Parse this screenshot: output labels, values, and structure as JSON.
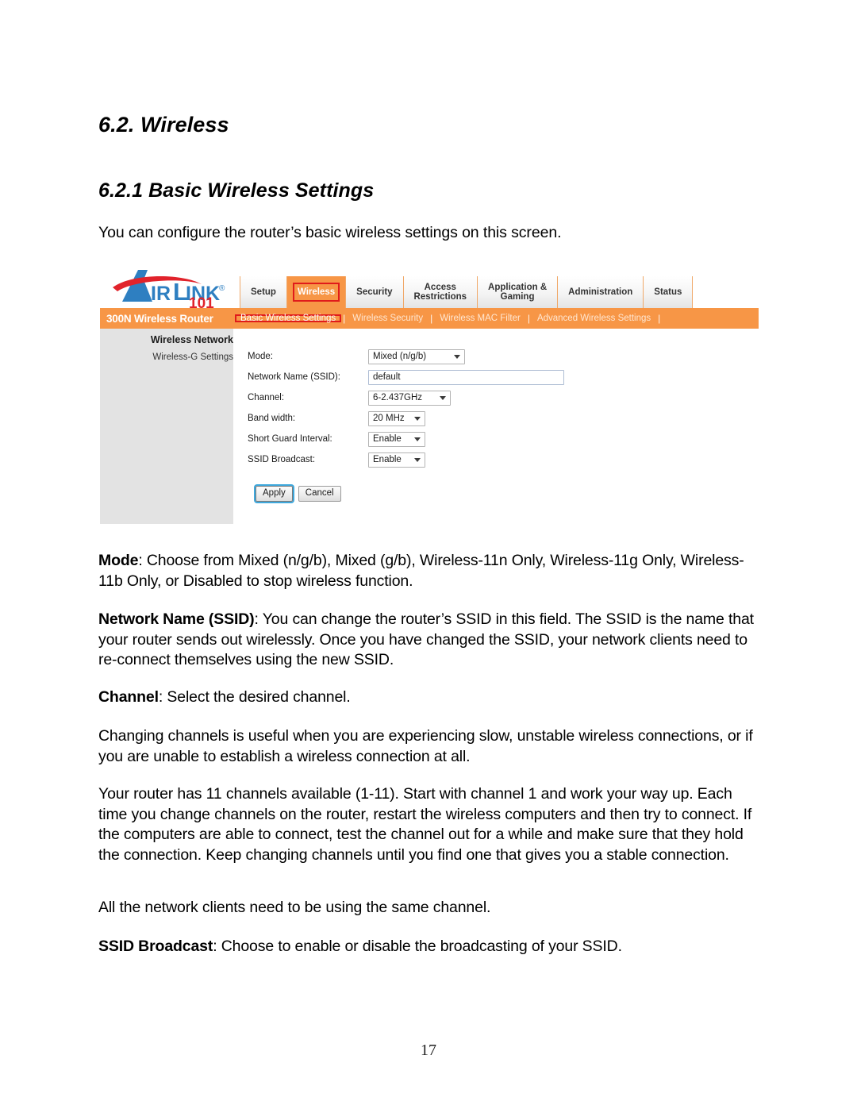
{
  "document": {
    "heading_major": "6.2. Wireless",
    "heading_minor": "6.2.1 Basic Wireless Settings",
    "intro": "You can configure the router’s basic wireless settings on this screen.",
    "page_number": "17"
  },
  "router_ui": {
    "brand": {
      "name_part1": "A",
      "name_part2": "IR",
      "name_part3": "L",
      "name_part4": "INK",
      "registered": "®",
      "model_number": "101",
      "logo_blue": "#2e7fc1",
      "logo_red": "#e1232b"
    },
    "product_label": "300N Wireless Router",
    "accent_orange": "#f79646",
    "highlight_red": "#e01b1b",
    "nav_tabs": [
      {
        "label": "Setup",
        "active": false
      },
      {
        "label": "Wireless",
        "active": true
      },
      {
        "label": "Security",
        "active": false
      },
      {
        "label": "Access\nRestrictions",
        "active": false
      },
      {
        "label": "Application &\nGaming",
        "active": false
      },
      {
        "label": "Administration",
        "active": false
      },
      {
        "label": "Status",
        "active": false
      }
    ],
    "sub_nav": [
      {
        "label": "Basic Wireless Settings",
        "active": true
      },
      {
        "label": "Wireless Security",
        "active": false
      },
      {
        "label": "Wireless MAC Filter",
        "active": false
      },
      {
        "label": "Advanced Wireless Settings",
        "active": false
      }
    ],
    "sub_nav_separator": "|",
    "sidebar": {
      "title": "Wireless Network",
      "items": [
        {
          "label": "Wireless-G Settings"
        }
      ]
    },
    "form": {
      "rows": [
        {
          "label": "Mode:",
          "value": "Mixed (n/g/b)",
          "type": "select"
        },
        {
          "label": "Network Name (SSID):",
          "value": "default",
          "type": "text"
        },
        {
          "label": "Channel:",
          "value": "6-2.437GHz",
          "type": "select"
        },
        {
          "label": "Band width:",
          "value": "20 MHz",
          "type": "select"
        },
        {
          "label": "Short Guard Interval:",
          "value": "Enable",
          "type": "select"
        },
        {
          "label": "SSID Broadcast:",
          "value": "Enable",
          "type": "select"
        }
      ]
    },
    "buttons": {
      "apply": "Apply",
      "cancel": "Cancel"
    }
  },
  "descriptions": {
    "mode_term": "Mode",
    "mode_text": ": Choose from Mixed (n/g/b), Mixed (g/b), Wireless-11n Only, Wireless-11g Only, Wireless-11b Only, or Disabled to stop wireless function.",
    "ssid_term": "Network Name (SSID)",
    "ssid_text": ": You can change the router’s SSID in this field. The SSID is the name that your router sends out wirelessly.  Once you have changed the SSID, your network clients need to re-connect themselves using the new SSID.",
    "channel_term": "Channel",
    "channel_text": ": Select the desired channel.",
    "changing_text": "Changing channels is useful when you are experiencing slow, unstable wireless connections, or if you are unable to establish a wireless connection at all.",
    "eleven_text": "Your router has 11 channels available (1-11).  Start with channel 1 and work your way up.  Each time you change channels on the router, restart the wireless computers and then try to connect.  If the computers are able to connect, test the channel out for a while and make sure that they hold the connection.  Keep changing channels until you find one that gives you a stable connection.",
    "allclients_text": "All the network clients need to be using the same channel.",
    "broadcast_term": "SSID Broadcast",
    "broadcast_text": ": Choose to enable or disable the broadcasting of your SSID."
  }
}
